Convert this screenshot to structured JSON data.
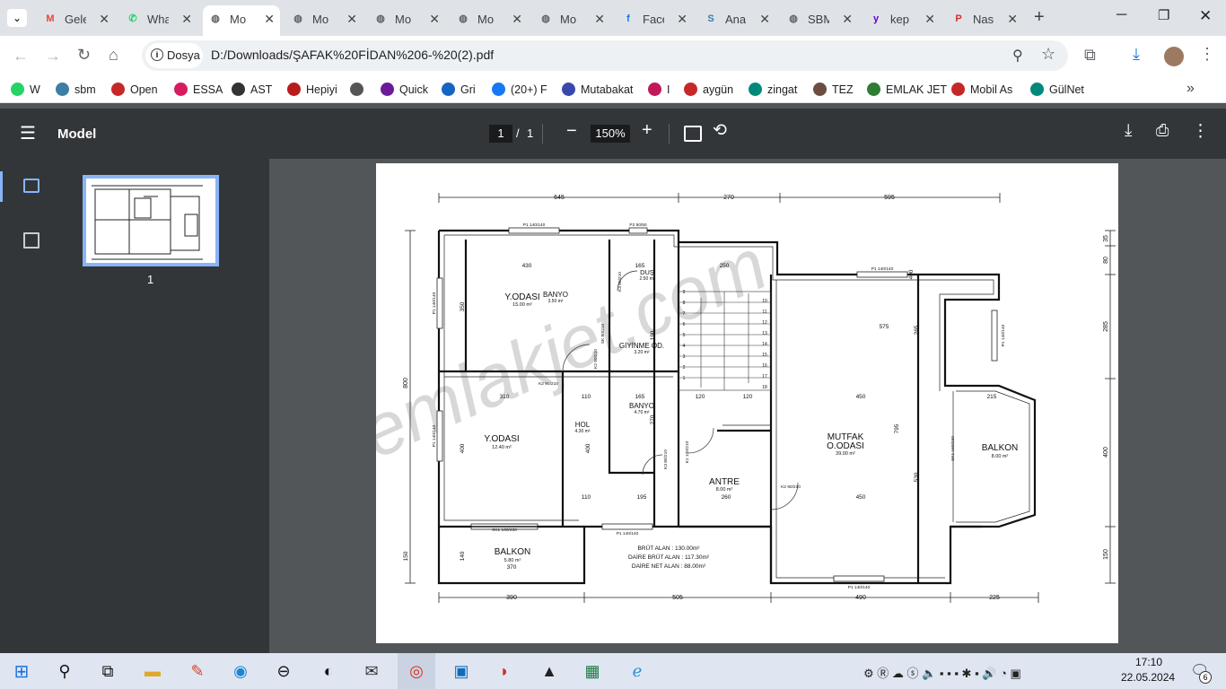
{
  "browser": {
    "tabs": [
      {
        "title": "Gele",
        "icon": "gmail-icon"
      },
      {
        "title": "Wha",
        "icon": "whatsapp-icon"
      },
      {
        "title": "Mo",
        "icon": "globe-icon",
        "active": true
      },
      {
        "title": "Mo",
        "icon": "globe-icon"
      },
      {
        "title": "Mo",
        "icon": "globe-icon"
      },
      {
        "title": "Mo",
        "icon": "globe-icon"
      },
      {
        "title": "Mo",
        "icon": "globe-icon"
      },
      {
        "title": "Face",
        "icon": "facebook-icon"
      },
      {
        "title": "Ana",
        "icon": "sahibinden-icon"
      },
      {
        "title": "SBM",
        "icon": "globe-icon"
      },
      {
        "title": "kep",
        "icon": "yahoo-icon"
      },
      {
        "title": "Nas",
        "icon": "pttavm-icon"
      }
    ],
    "site_label": "Dosya",
    "url": "D:/Downloads/ŞAFAK%20FİDAN%206-%20(2).pdf",
    "bookmarks": [
      "W",
      "sbm",
      "Open",
      "ESSA",
      "AST",
      "Hepiyi",
      "",
      "Quick",
      "Gri",
      "(20+) F",
      "Mutabakat",
      "I",
      "aygün",
      "zingat",
      "TEZ",
      "EMLAK JET",
      "Mobil As",
      "GülNet"
    ]
  },
  "pdf": {
    "title": "Model",
    "page_current": "1",
    "page_separator": "/",
    "page_total": "1",
    "zoom": "150%",
    "thumbnail_label": "1"
  },
  "plan": {
    "watermark": "emlakjet.com",
    "top_dims": [
      "645",
      "270",
      "595"
    ],
    "bottom_dims": [
      "390",
      "505",
      "490",
      "225"
    ],
    "left_dims": [
      "800"
    ],
    "right_dims": [
      "35",
      "80",
      "285",
      "400",
      "150"
    ],
    "inner_dims": [
      "430",
      "165",
      "250",
      "350",
      "190",
      "310",
      "110",
      "165",
      "120",
      "120",
      "450",
      "400",
      "400",
      "270",
      "575",
      "265",
      "795",
      "530",
      "215",
      "110",
      "195",
      "260",
      "450",
      "150",
      "140",
      "370",
      "400"
    ],
    "window_tags": [
      "P1 140/140",
      "P2 50/50",
      "P1 140/140",
      "P1 140/140",
      "P1 140/140",
      "P1 140/140",
      "P1 140/140",
      "SK1 160/230",
      "P1 140/140"
    ],
    "door_tags": [
      "K2 90/210",
      "K2 90/210",
      "K3 80/210",
      "K3 80/210",
      "SK 80/210",
      "K1 100/210",
      "K2 90/210",
      "SK1 160/230"
    ],
    "stair_numbers_left": [
      "9",
      "8",
      "7",
      "6",
      "5",
      "4",
      "3",
      "2",
      "1"
    ],
    "stair_numbers_right": [
      "10",
      "11",
      "12",
      "13",
      "14",
      "15",
      "16",
      "17",
      "18"
    ],
    "rooms": [
      {
        "name": "Y.ODASI",
        "area": "15.00 m²"
      },
      {
        "name": "BANYO",
        "area": "3.50 m²"
      },
      {
        "name": "DUŞ",
        "area": "2.50 m²"
      },
      {
        "name": "GİYİNME OD.",
        "area": "3.20 m²"
      },
      {
        "name": "Y.ODASI",
        "area": "12.40 m²"
      },
      {
        "name": "HOL",
        "area": "4.30 m²"
      },
      {
        "name": "BANYO",
        "area": "4.70 m²"
      },
      {
        "name": "ANTRE",
        "area": "8.00 m²"
      },
      {
        "name": "MUTFAK",
        "area": ""
      },
      {
        "name": "O.ODASI",
        "area": "39.00 m²"
      },
      {
        "name": "BALKON",
        "area": "8.00 m²"
      },
      {
        "name": "BALKON",
        "area": "5.80 m²"
      }
    ],
    "summary": [
      "BRÜT ALAN : 130.00m²",
      "DAİRE BRÜT ALAN : 117.30m²",
      "DAİRE NET ALAN : 88.00m²"
    ]
  },
  "taskbar": {
    "time": "17:10",
    "date": "22.05.2024",
    "notification_count": "6"
  }
}
